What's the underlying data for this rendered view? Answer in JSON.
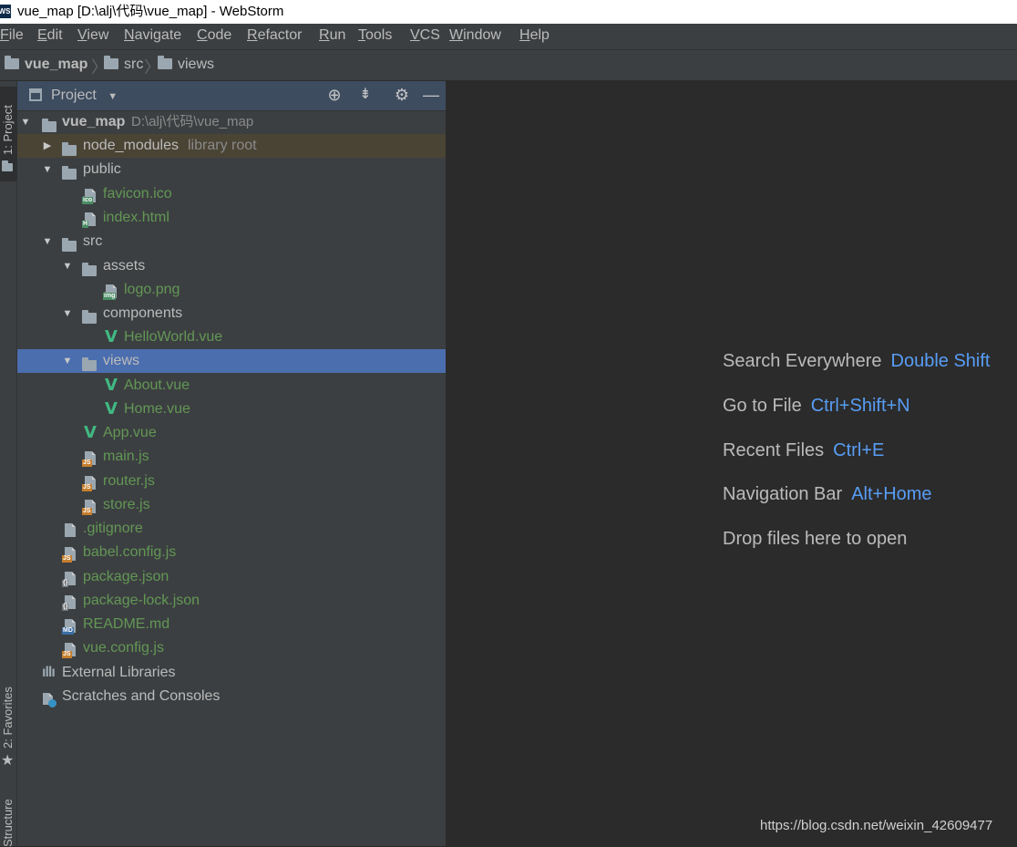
{
  "window": {
    "app_icon_label": "WS",
    "title": "vue_map [D:\\alj\\代码\\vue_map] - WebStorm"
  },
  "menu": [
    "File",
    "Edit",
    "View",
    "Navigate",
    "Code",
    "Refactor",
    "Run",
    "Tools",
    "VCS",
    "Window",
    "Help"
  ],
  "breadcrumb": [
    "vue_map",
    "src",
    "views"
  ],
  "tool_strip": {
    "project": "1: Project",
    "favorites": "2: Favorites",
    "structure": "Structure"
  },
  "project_panel": {
    "title": "Project",
    "icons": [
      "locate-icon",
      "collapse-all-icon",
      "gear-icon",
      "minimize-icon"
    ]
  },
  "tree": [
    {
      "label": "vue_map",
      "hint": "D:\\alj\\代码\\vue_map",
      "type": "folder",
      "expanded": true
    },
    {
      "label": "node_modules",
      "hint": "library root",
      "type": "folder",
      "expanded": false
    },
    {
      "label": "public",
      "type": "folder",
      "expanded": true
    },
    {
      "label": "favicon.ico",
      "type": "file",
      "badge": "ico"
    },
    {
      "label": "index.html",
      "type": "file",
      "badge": "H"
    },
    {
      "label": "src",
      "type": "folder",
      "expanded": true
    },
    {
      "label": "assets",
      "type": "folder",
      "expanded": true
    },
    {
      "label": "logo.png",
      "type": "file",
      "badge": "img"
    },
    {
      "label": "components",
      "type": "folder",
      "expanded": true
    },
    {
      "label": "HelloWorld.vue",
      "type": "vue"
    },
    {
      "label": "views",
      "type": "folder",
      "expanded": true,
      "selected": true
    },
    {
      "label": "About.vue",
      "type": "vue"
    },
    {
      "label": "Home.vue",
      "type": "vue"
    },
    {
      "label": "App.vue",
      "type": "vue"
    },
    {
      "label": "main.js",
      "type": "file",
      "badge": "JS"
    },
    {
      "label": "router.js",
      "type": "file",
      "badge": "JS"
    },
    {
      "label": "store.js",
      "type": "file",
      "badge": "JS"
    },
    {
      "label": ".gitignore",
      "type": "file",
      "badge": "txt"
    },
    {
      "label": "babel.config.js",
      "type": "file",
      "badge": "JS"
    },
    {
      "label": "package.json",
      "type": "file",
      "badge": "{}"
    },
    {
      "label": "package-lock.json",
      "type": "file",
      "badge": "{}"
    },
    {
      "label": "README.md",
      "type": "file",
      "badge": "MD"
    },
    {
      "label": "vue.config.js",
      "type": "file",
      "badge": "JS"
    },
    {
      "label": "External Libraries",
      "type": "libraries"
    },
    {
      "label": "Scratches and Consoles",
      "type": "scratches"
    }
  ],
  "editor": {
    "tips": [
      {
        "label": "Search Everywhere",
        "shortcut": "Double Shift"
      },
      {
        "label": "Go to File",
        "shortcut": "Ctrl+Shift+N"
      },
      {
        "label": "Recent Files",
        "shortcut": "Ctrl+E"
      },
      {
        "label": "Navigation Bar",
        "shortcut": "Alt+Home"
      }
    ],
    "drop_hint": "Drop files here to open"
  },
  "watermark": "https://blog.csdn.net/weixin_42609477",
  "colors": {
    "selection": "#4b6eaf",
    "library_root_bg": "#4a4435",
    "file_green": "#629755",
    "shortcut_blue": "#589df6",
    "vue_green": "#41b883"
  }
}
